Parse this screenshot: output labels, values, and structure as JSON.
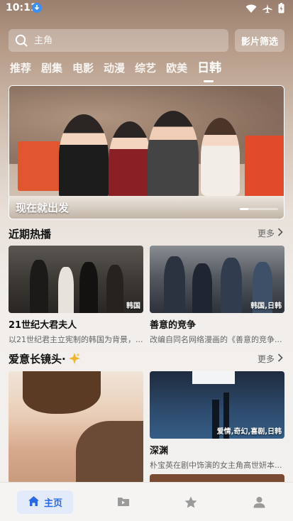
{
  "status_bar": {
    "time": "10:11"
  },
  "search": {
    "placeholder": "主角",
    "filter_label": "影片筛选"
  },
  "tabs": [
    {
      "label": "推荐"
    },
    {
      "label": "剧集"
    },
    {
      "label": "电影"
    },
    {
      "label": "动漫"
    },
    {
      "label": "综艺"
    },
    {
      "label": "欧美"
    },
    {
      "label": "日韩",
      "active": true
    }
  ],
  "banner": {
    "caption": "现在就出发"
  },
  "recent": {
    "title": "近期热播",
    "more": "更多",
    "items": [
      {
        "title": "21世纪大君夫人",
        "tag": "韩国",
        "desc": "以21世纪君主立宪制的韩国为背景，..."
      },
      {
        "title": "善意的竞争",
        "tag": "韩国,日韩",
        "desc": "改编自同名网络漫画的《善意的竞争..."
      }
    ]
  },
  "love": {
    "title": "爱意长镜头·",
    "more": "更多",
    "items": [
      {
        "title": "深渊",
        "tag": "爱情,奇幻,喜剧,日韩",
        "desc": "朴宝英在剧中饰演的女主角高世妍本..."
      }
    ]
  },
  "bottom_nav": {
    "home_label": "主页"
  },
  "colors": {
    "accent": "#2a6ae0",
    "home_bg": "#e3ebfb"
  }
}
